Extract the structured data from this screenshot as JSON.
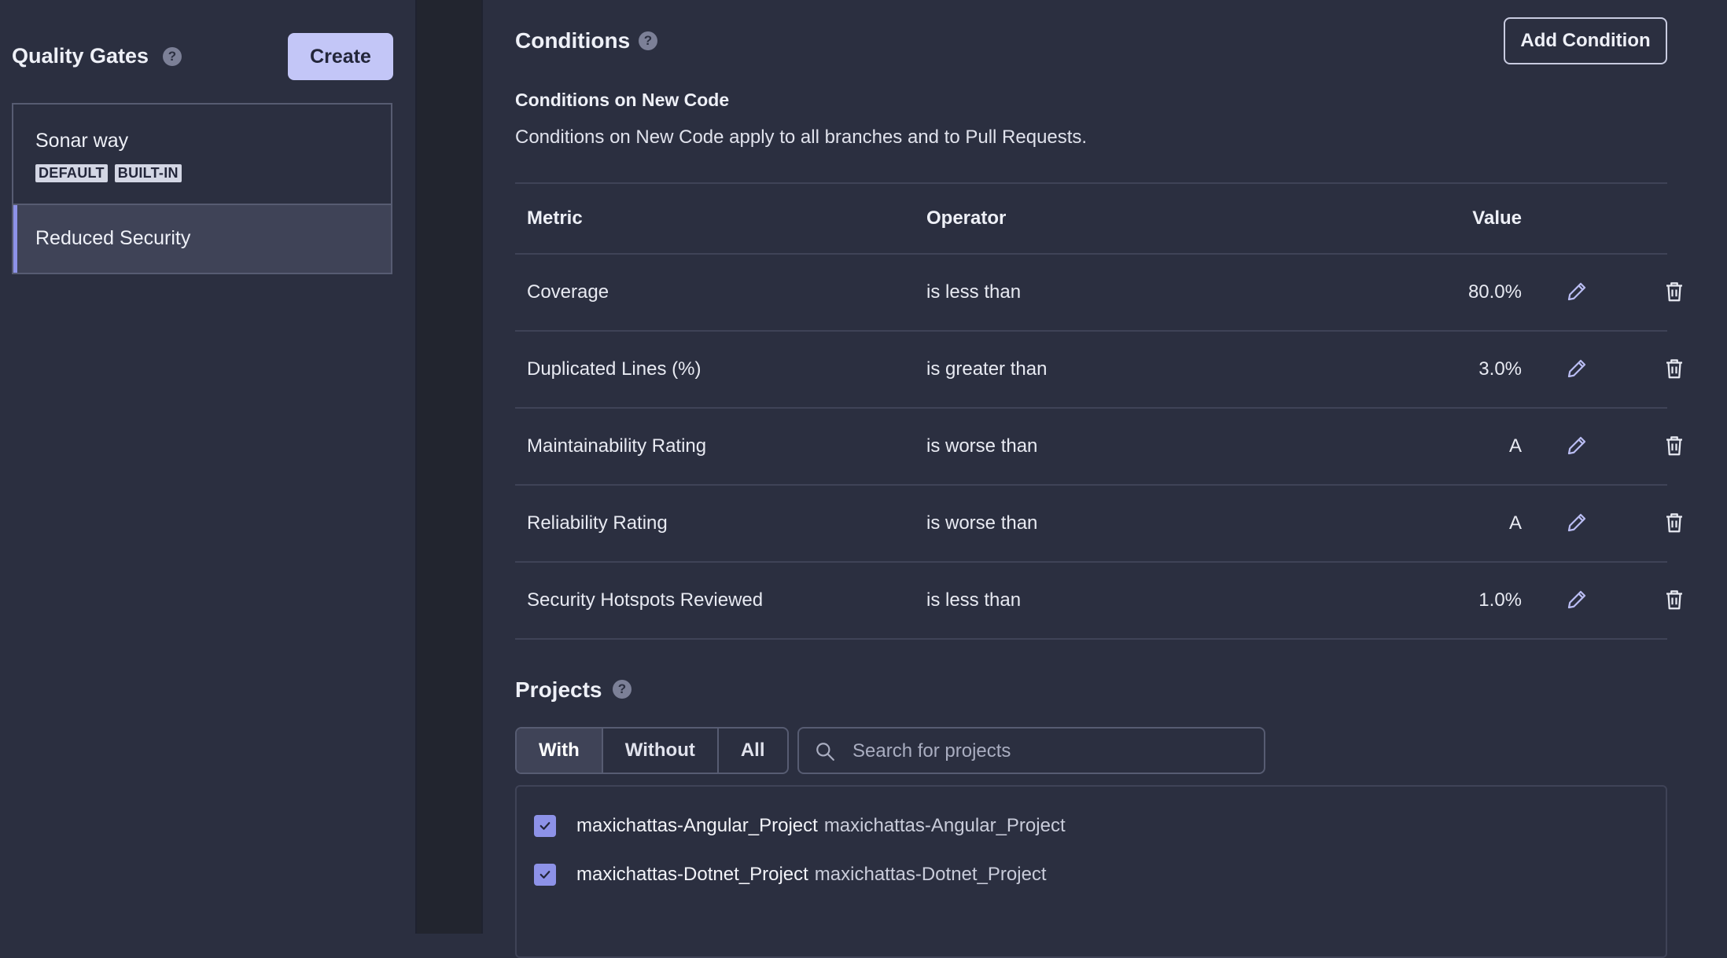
{
  "sidebar": {
    "title": "Quality Gates",
    "create_label": "Create",
    "gates": [
      {
        "name": "Sonar way",
        "badges": [
          "DEFAULT",
          "BUILT-IN"
        ]
      },
      {
        "name": "Reduced Security"
      }
    ]
  },
  "conditions": {
    "title": "Conditions",
    "add_label": "Add Condition",
    "new_code_title": "Conditions on New Code",
    "new_code_desc": "Conditions on New Code apply to all branches and to Pull Requests.",
    "columns": [
      "Metric",
      "Operator",
      "Value"
    ],
    "rows": [
      {
        "metric": "Coverage",
        "operator": "is less than",
        "value": "80.0%"
      },
      {
        "metric": "Duplicated Lines (%)",
        "operator": "is greater than",
        "value": "3.0%"
      },
      {
        "metric": "Maintainability Rating",
        "operator": "is worse than",
        "value": "A"
      },
      {
        "metric": "Reliability Rating",
        "operator": "is worse than",
        "value": "A"
      },
      {
        "metric": "Security Hotspots Reviewed",
        "operator": "is less than",
        "value": "1.0%"
      }
    ]
  },
  "projects": {
    "title": "Projects",
    "filters": [
      "With",
      "Without",
      "All"
    ],
    "active_filter": "With",
    "search_placeholder": "Search for projects",
    "items": [
      {
        "key": "maxichattas-Angular_Project",
        "name": "maxichattas-Angular_Project",
        "checked": true
      },
      {
        "key": "maxichattas-Dotnet_Project",
        "name": "maxichattas-Dotnet_Project",
        "checked": true
      }
    ]
  },
  "colors": {
    "background": "#2b2f40",
    "accent": "#8d92e8",
    "primary_button": "#c3c6f7",
    "border": "#575c72"
  }
}
